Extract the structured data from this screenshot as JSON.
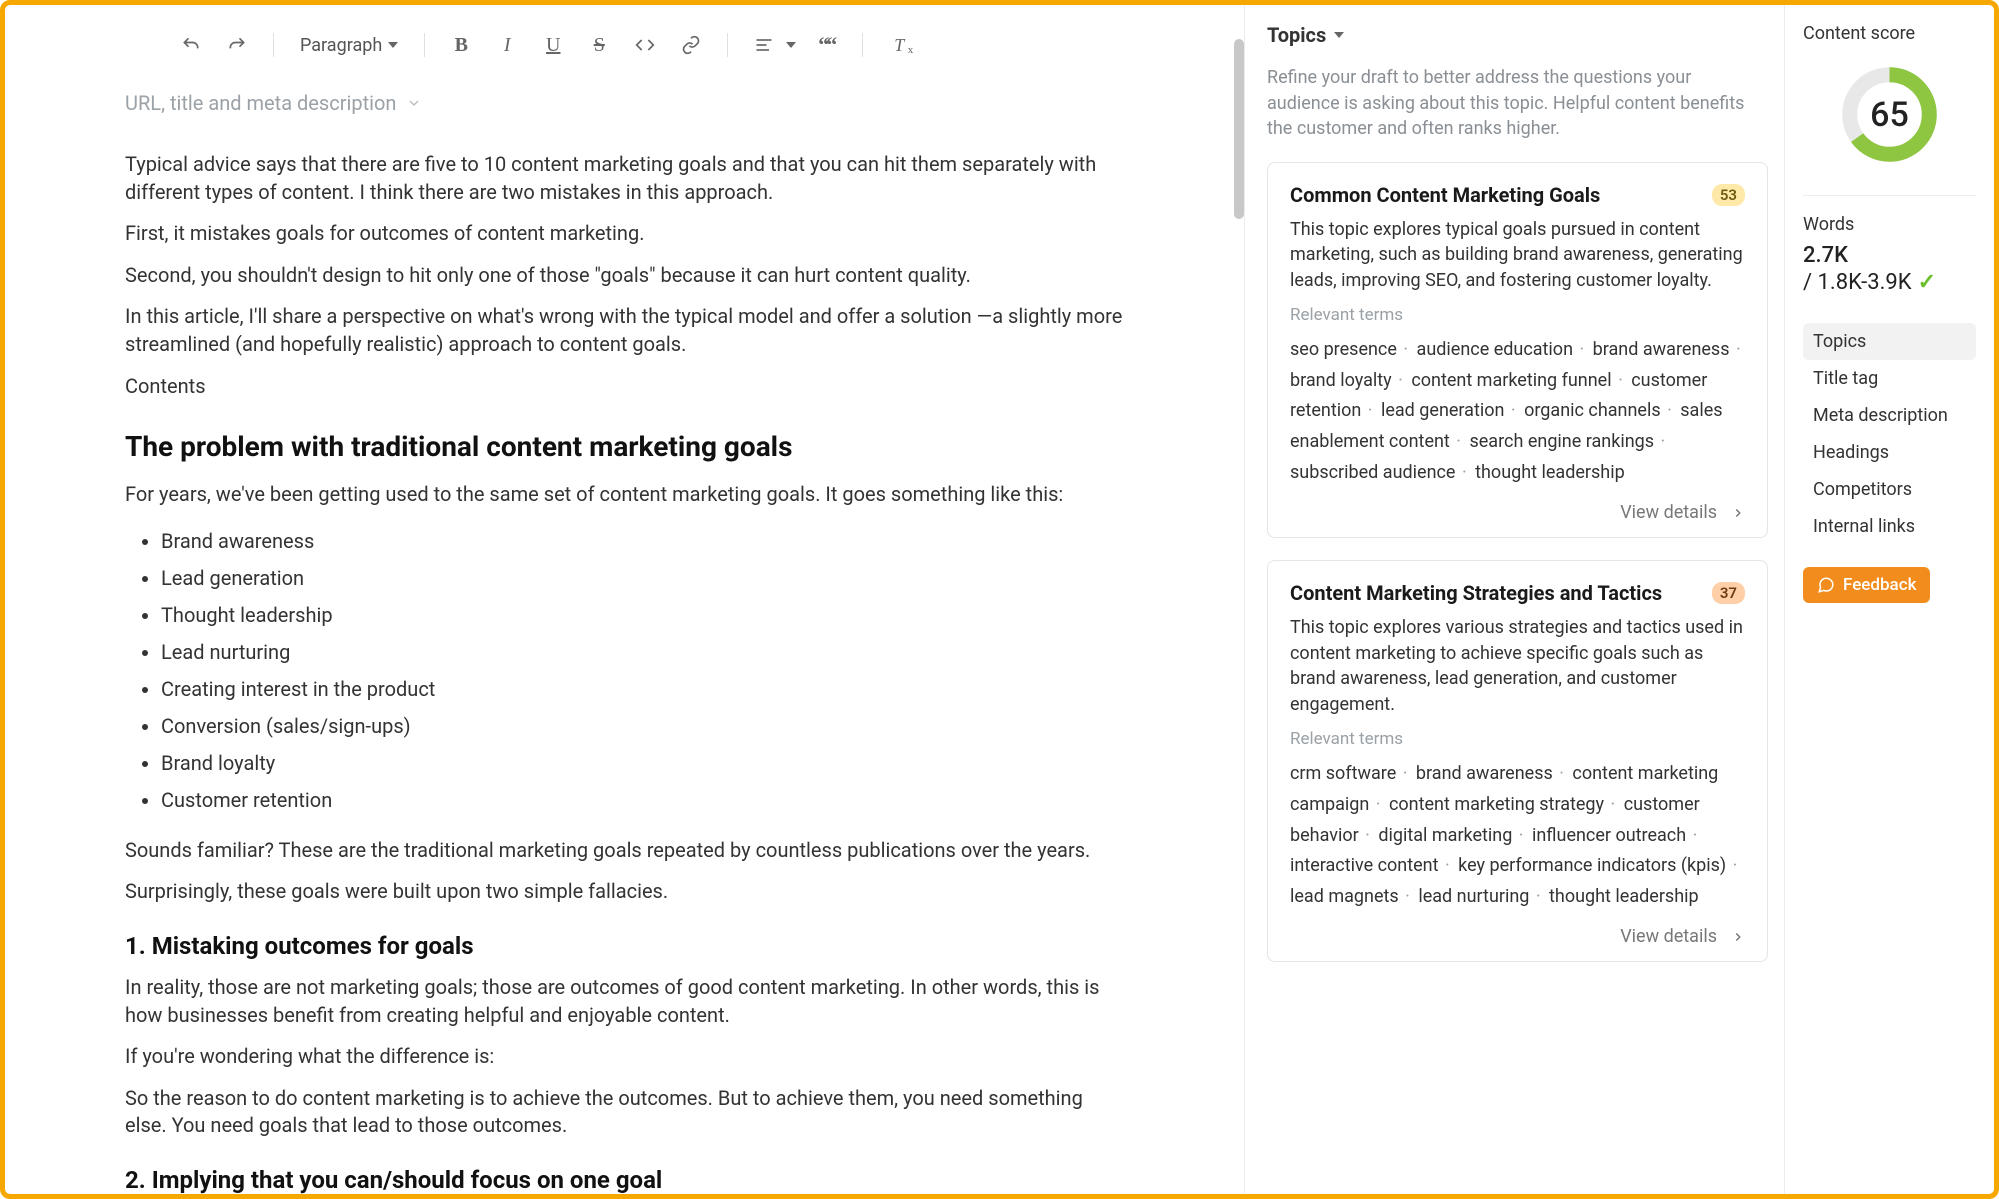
{
  "toolbar": {
    "paragraph_label": "Paragraph"
  },
  "meta": {
    "url_meta_label": "URL, title and meta description"
  },
  "content": {
    "p1": "Typical advice says that there are five to 10 content marketing goals and that you can hit them separately with different types of content. I think there are two mistakes in this approach.",
    "p2": "First, it mistakes goals for outcomes of content marketing.",
    "p3": "Second, you shouldn't design to hit only one of those \"goals\" because it can hurt content quality.",
    "p4": "In this article, I'll share a perspective on what's wrong with the typical model and offer a solution —a slightly more streamlined (and hopefully realistic) approach to content goals.",
    "p5": "Contents",
    "h2a": "The problem with traditional content marketing goals",
    "p6": "For years, we've been getting used to the same set of content marketing goals. It goes something like this:",
    "list": [
      "Brand awareness",
      "Lead generation",
      "Thought leadership",
      "Lead nurturing",
      "Creating interest in the product",
      "Conversion (sales/sign-ups)",
      "Brand loyalty",
      "Customer retention"
    ],
    "p7": "Sounds familiar? These are the traditional marketing goals repeated by countless publications over the years.",
    "p8": "Surprisingly, these goals were built upon two simple fallacies.",
    "h3a": "1. Mistaking outcomes for goals",
    "p9": "In reality, those are not marketing goals; those are outcomes of good content marketing. In other words, this is how businesses benefit from creating helpful and enjoyable content.",
    "p10": "If you're wondering what the difference is:",
    "p11": "So the reason to do content marketing is to achieve the outcomes. But to achieve them, you need something else. You need goals that lead to those outcomes.",
    "h3b": "2. Implying that you can/should focus on one goal"
  },
  "topics": {
    "header": "Topics",
    "intro": "Refine your draft to better address the questions your audience is asking about this topic. Helpful content benefits the customer and often ranks higher.",
    "relevant_label": "Relevant terms",
    "view_details": "View details",
    "cards": [
      {
        "title": "Common Content Marketing Goals",
        "badge": "53",
        "badge_style": "y",
        "desc": "This topic explores typical goals pursued in content marketing, such as building brand awareness, generating leads, improving SEO, and fostering customer loyalty.",
        "terms": [
          "seo presence",
          "audience education",
          "brand awareness",
          "brand loyalty",
          "content marketing funnel",
          "customer retention",
          "lead generation",
          "organic channels",
          "sales enablement content",
          "search engine rankings",
          "subscribed audience",
          "thought leadership"
        ]
      },
      {
        "title": "Content Marketing Strategies and Tactics",
        "badge": "37",
        "badge_style": "o",
        "desc": "This topic explores various strategies and tactics used in content marketing to achieve specific goals such as brand awareness, lead generation, and customer engagement.",
        "terms": [
          "crm software",
          "brand awareness",
          "content marketing campaign",
          "content marketing strategy",
          "customer behavior",
          "digital marketing",
          "influencer outreach",
          "interactive content",
          "key performance indicators (kpis)",
          "lead magnets",
          "lead nurturing",
          "thought leadership"
        ]
      }
    ]
  },
  "score": {
    "label": "Content score",
    "value": "65",
    "percent": 65,
    "words_label": "Words",
    "words_value": "2.7K",
    "words_range": "/ 1.8K-3.9K",
    "nav": [
      "Topics",
      "Title tag",
      "Meta description",
      "Headings",
      "Competitors",
      "Internal links"
    ],
    "feedback": "Feedback"
  }
}
